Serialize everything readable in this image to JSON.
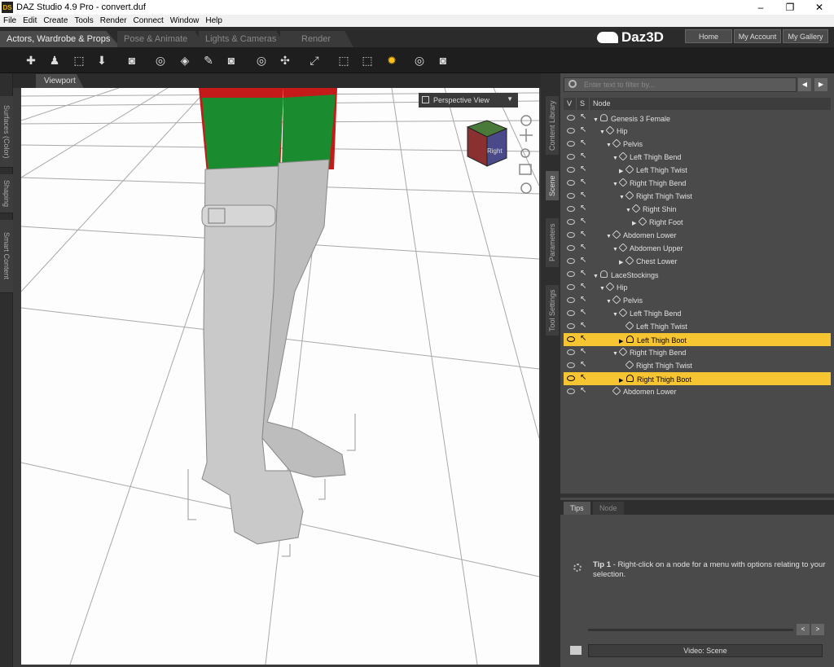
{
  "window": {
    "title": "DAZ Studio 4.9 Pro - convert.duf",
    "app_icon": "DS",
    "controls": [
      "–",
      "❐",
      "✕"
    ]
  },
  "menu": [
    "File",
    "Edit",
    "Create",
    "Tools",
    "Render",
    "Connect",
    "Window",
    "Help"
  ],
  "activities": [
    "Actors, Wardrobe & Props",
    "Pose & Animate",
    "Lights & Cameras",
    "Render"
  ],
  "brand": "Daz3D",
  "top_buttons": [
    "Home",
    "My Account",
    "My Gallery"
  ],
  "left_tabs": [
    "Surfaces (Color)",
    "Shaping",
    "Smart Content"
  ],
  "viewport": {
    "tab": "Viewport",
    "view_select": "Perspective View",
    "cube_label": "Right"
  },
  "right_tabs": [
    "Content Library",
    "Scene",
    "Parameters",
    "Tool Settings"
  ],
  "scene": {
    "filter_placeholder": "Enter text to filter by...",
    "columns": [
      "V",
      "S",
      "Node"
    ],
    "nodes": [
      {
        "label": "Genesis 3 Female",
        "depth": 0,
        "expand": "▼",
        "kind": "figure",
        "selected": false
      },
      {
        "label": "Hip",
        "depth": 1,
        "expand": "▼",
        "kind": "bone",
        "selected": false
      },
      {
        "label": "Pelvis",
        "depth": 2,
        "expand": "▼",
        "kind": "bone",
        "selected": false
      },
      {
        "label": "Left Thigh Bend",
        "depth": 3,
        "expand": "▼",
        "kind": "bone",
        "selected": false
      },
      {
        "label": "Left Thigh Twist",
        "depth": 4,
        "expand": "▶",
        "kind": "bone",
        "selected": false
      },
      {
        "label": "Right Thigh Bend",
        "depth": 3,
        "expand": "▼",
        "kind": "bone",
        "selected": false
      },
      {
        "label": "Right Thigh Twist",
        "depth": 4,
        "expand": "▼",
        "kind": "bone",
        "selected": false
      },
      {
        "label": "Right Shin",
        "depth": 5,
        "expand": "▼",
        "kind": "bone",
        "selected": false
      },
      {
        "label": "Right Foot",
        "depth": 6,
        "expand": "▶",
        "kind": "bone",
        "selected": false
      },
      {
        "label": "Abdomen Lower",
        "depth": 2,
        "expand": "▼",
        "kind": "bone",
        "selected": false
      },
      {
        "label": "Abdomen Upper",
        "depth": 3,
        "expand": "▼",
        "kind": "bone",
        "selected": false
      },
      {
        "label": "Chest Lower",
        "depth": 4,
        "expand": "▶",
        "kind": "bone",
        "selected": false
      },
      {
        "label": "LaceStockings",
        "depth": 0,
        "expand": "▼",
        "kind": "figure",
        "selected": false
      },
      {
        "label": "Hip",
        "depth": 1,
        "expand": "▼",
        "kind": "bone",
        "selected": false
      },
      {
        "label": "Pelvis",
        "depth": 2,
        "expand": "▼",
        "kind": "bone",
        "selected": false
      },
      {
        "label": "Left Thigh Bend",
        "depth": 3,
        "expand": "▼",
        "kind": "bone",
        "selected": false
      },
      {
        "label": "Left Thigh Twist",
        "depth": 4,
        "expand": "",
        "kind": "bone",
        "selected": false
      },
      {
        "label": "Left Thigh Boot",
        "depth": 4,
        "expand": "▶",
        "kind": "figure",
        "selected": true
      },
      {
        "label": "Right Thigh Bend",
        "depth": 3,
        "expand": "▼",
        "kind": "bone",
        "selected": false
      },
      {
        "label": "Right Thigh Twist",
        "depth": 4,
        "expand": "",
        "kind": "bone",
        "selected": false
      },
      {
        "label": "Right Thigh Boot",
        "depth": 4,
        "expand": "▶",
        "kind": "figure",
        "selected": true
      },
      {
        "label": "Abdomen Lower",
        "depth": 2,
        "expand": "",
        "kind": "bone",
        "selected": false
      }
    ]
  },
  "tips": {
    "tabs": [
      "Tips",
      "Node"
    ],
    "tip_number": "Tip 1",
    "tip_text": " - Right-click on a node for a menu with options relating to your selection.",
    "prev": "<",
    "next": ">",
    "video_button": "Video: Scene"
  },
  "colors": {
    "selection": "#f7c531",
    "accent_bulb": "#ffc21c"
  }
}
